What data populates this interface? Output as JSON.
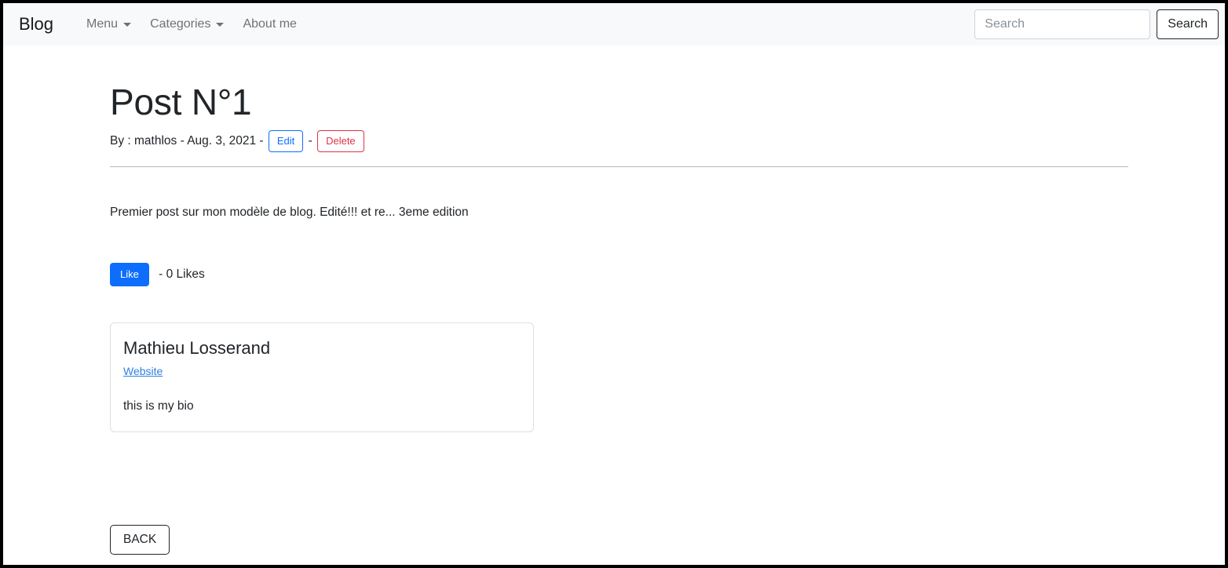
{
  "navbar": {
    "brand": "Blog",
    "items": [
      {
        "label": "Menu",
        "has_caret": true,
        "icon": "chevron-down-icon"
      },
      {
        "label": "Categories",
        "has_caret": true,
        "icon": "chevron-down-icon"
      },
      {
        "label": "About me",
        "has_caret": false,
        "icon": ""
      }
    ],
    "search": {
      "placeholder": "Search",
      "value": "",
      "button_label": "Search"
    },
    "background_color": "#f8f9fa"
  },
  "post": {
    "title": "Post N°1",
    "byline_prefix": "By : mathlos - Aug. 3, 2021 - ",
    "byline_separator": " - ",
    "edit_label": "Edit",
    "delete_label": "Delete",
    "body": "Premier post sur mon modèle de blog. Edité!!! et re... 3eme edition",
    "like_label": "Like",
    "like_count_text": " - 0 Likes"
  },
  "author_card": {
    "name": "Mathieu Losserand",
    "website_label": "Website",
    "bio": "this is my bio"
  },
  "footer": {
    "back_label": "BACK"
  },
  "colors": {
    "primary": "#0d6efd",
    "danger": "#dc3545",
    "link": "#2f7fe0",
    "text": "#212529",
    "nav_text": "rgba(0,0,0,.55)",
    "navbar_bg": "#f8f9fa",
    "border": "#dfdfdf"
  }
}
